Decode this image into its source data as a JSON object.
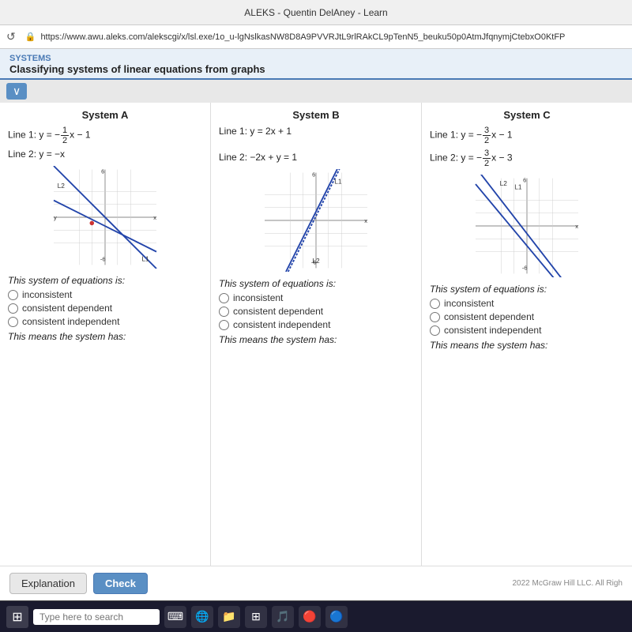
{
  "browser": {
    "title": "ALEKS - Quentin DelAney - Learn",
    "url": "https://www.awu.aleks.com/alekscgi/x/lsl.exe/1o_u-lgNslkasNW8D8A9PVVRJtL9rlRAkCL9pTenN5_beuku50p0AtmJfqnymjCtebxO0KtFP",
    "reload_icon": "↺"
  },
  "page": {
    "systems_label": "SYSTEMS",
    "page_title": "Classifying systems of linear equations from graphs"
  },
  "systems": [
    {
      "title": "System A",
      "line1_label": "Line 1: y = −",
      "line1_fraction_num": "1",
      "line1_fraction_den": "2",
      "line1_suffix": "x − 1",
      "line2_label": "Line 2: y = −x",
      "status_text": "This system of equations is:",
      "options": [
        "inconsistent",
        "consistent dependent",
        "consistent independent"
      ],
      "means_text": "This means the system has:"
    },
    {
      "title": "System B",
      "line1_label": "Line 1: y = 2x + 1",
      "line2_label": "Line 2: −2x + y = 1",
      "status_text": "This system of equations is:",
      "options": [
        "inconsistent",
        "consistent dependent",
        "consistent independent"
      ],
      "means_text": "This means the system has:"
    },
    {
      "title": "System C",
      "line1_label": "Line 1: y = −",
      "line1_fraction_num": "3",
      "line1_fraction_den": "2",
      "line1_suffix": "x − 1",
      "line2_label": "Line 2: y = −",
      "line2_fraction_num": "3",
      "line2_fraction_den": "2",
      "line2_suffix": "x − 3",
      "status_text": "This system of equations is:",
      "options": [
        "inconsistent",
        "consistent dependent",
        "consistent independent"
      ],
      "means_text": "This means the system has:"
    }
  ],
  "buttons": {
    "explanation": "Explanation",
    "check": "Check"
  },
  "copyright": "2022 McGraw Hill LLC. All Righ",
  "taskbar": {
    "search_placeholder": "Type here to search",
    "icons": [
      "⊞",
      "⌨",
      "🌐",
      "📁",
      "⊞",
      "🎵",
      "🔴",
      "🔵"
    ]
  },
  "colors": {
    "accent": "#4a7ab5",
    "line1_color": "#2244aa",
    "line2_color": "#2244aa",
    "grid_color": "#cccccc",
    "axis_color": "#555555"
  }
}
